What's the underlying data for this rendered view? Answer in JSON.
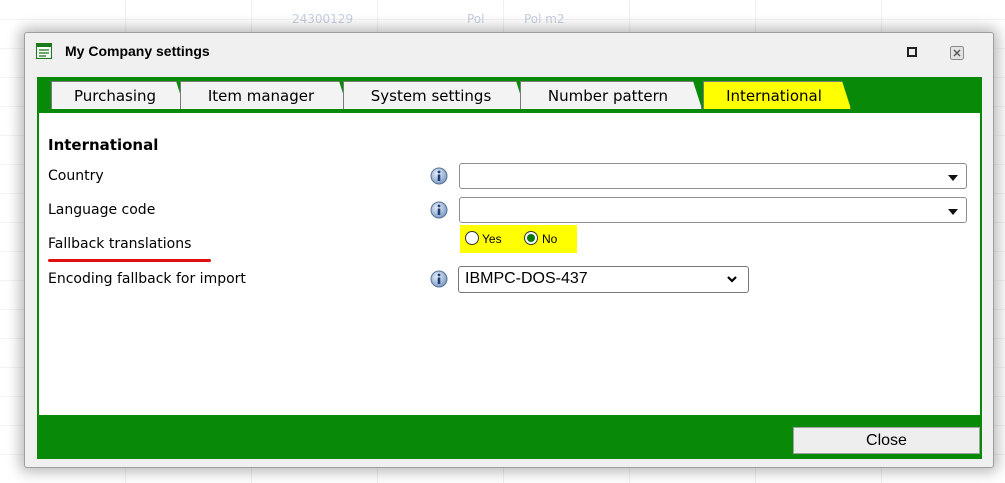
{
  "background": {
    "text_1": "24300129",
    "text_2": "Pol",
    "text_3": "Pol m2"
  },
  "window": {
    "title": "My Company settings",
    "title_icon": "form-icon",
    "accent_color": "#088a08",
    "highlight_color": "#ffff00"
  },
  "tabs": [
    {
      "label": "Purchasing",
      "active": false
    },
    {
      "label": "Item manager",
      "active": false
    },
    {
      "label": "System settings",
      "active": false
    },
    {
      "label": "Number pattern",
      "active": false
    },
    {
      "label": "International",
      "active": true
    }
  ],
  "form": {
    "heading": "International",
    "country": {
      "label": "Country",
      "value": ""
    },
    "language_code": {
      "label": "Language code",
      "value": ""
    },
    "fallback_translations": {
      "label": "Fallback translations",
      "options": [
        "Yes",
        "No"
      ],
      "selected": "No"
    },
    "encoding_fallback": {
      "label": "Encoding fallback for import",
      "value": "IBMPC-DOS-437"
    }
  },
  "footer": {
    "close_label": "Close"
  }
}
